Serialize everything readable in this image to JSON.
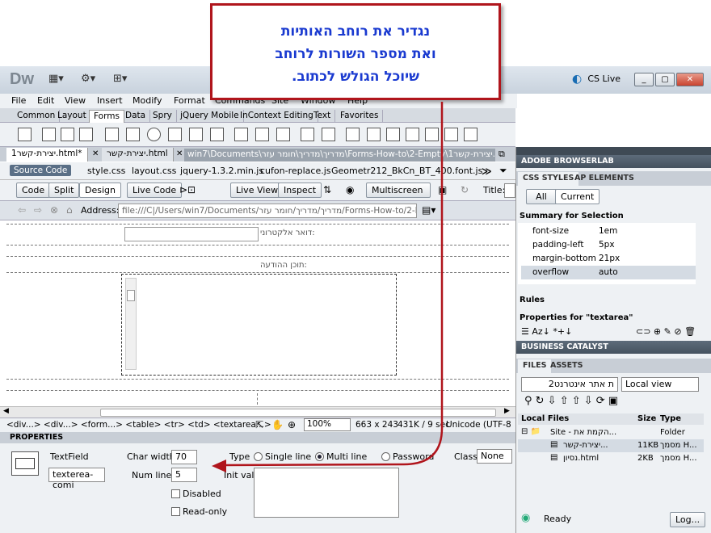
{
  "app": {
    "logo": "Dw",
    "cs_live": "CS Live"
  },
  "window_buttons": [
    "_",
    "▢",
    "✕"
  ],
  "menu": [
    "File",
    "Edit",
    "View",
    "Insert",
    "Modify",
    "Format",
    "Commands",
    "Site",
    "Window",
    "Help"
  ],
  "insert_tabs": [
    "Common",
    "Layout",
    "Forms",
    "Data",
    "Spry",
    "jQuery Mobile",
    "InContext Editing",
    "Text",
    "Favorites"
  ],
  "doc_tabs": [
    "יצירת-קשר1.html*",
    "יצירת-קשר.html",
    "win7\\Documents\\מדריך\\מדריך\\חומר עזר\\Forms-How-to\\2-Empty\\יצירת-קשר1.html"
  ],
  "related": {
    "source": "Source Code",
    "files": [
      "style.css",
      "layout.css",
      "jquery-1.3.2.min.js",
      "cufon-replace.js",
      "Geometr212_BkCn_BT_400.font.js"
    ]
  },
  "docbar": {
    "code": "Code",
    "split": "Split",
    "design": "Design",
    "live_code": "Live Code",
    "live_view": "Live View",
    "inspect": "Inspect",
    "multiscreen": "Multiscreen",
    "title_label": "Title:"
  },
  "address": {
    "label": "Address:",
    "value": "file:///C|/Users/win7/Documents/מדריך/מדריך/חומר עזר/Forms-How-to/2-En"
  },
  "design": {
    "label_email": "דואר אלקטרוני:",
    "label_message": "תוכן ההודעה:"
  },
  "status": {
    "tags": "<div...> <div...> <form...> <table> <tr> <td> <textarea...>",
    "zoom": "100%",
    "size": "663 x 243",
    "weight": "431K / 9 sec",
    "encoding": "Unicode (UTF-8"
  },
  "properties": {
    "header": "PROPERTIES",
    "type_name": "TextField",
    "field_id": "texterea-comi",
    "char_width_label": "Char width",
    "char_width": "70",
    "num_lines_label": "Num lines",
    "num_lines": "5",
    "type_label": "Type",
    "single": "Single line",
    "multi": "Multi line",
    "password": "Password",
    "class_label": "Class",
    "class_value": "None",
    "init_label": "Init val",
    "disabled": "Disabled",
    "readonly": "Read-only"
  },
  "right": {
    "browserlab": "ADOBE BROWSERLAB",
    "css_tab": "CSS STYLES",
    "ap_tab": "AP ELEMENTS",
    "all": "All",
    "current": "Current",
    "summary": "Summary for Selection",
    "rules": [
      {
        "k": "font-size",
        "v": "1em"
      },
      {
        "k": "padding-left",
        "v": "5px"
      },
      {
        "k": "margin-bottom",
        "v": "21px"
      },
      {
        "k": "overflow",
        "v": "auto"
      }
    ],
    "rules_label": "Rules",
    "props_for": "Properties for \"textarea\"",
    "business": "BUSINESS CATALYST",
    "files_tab": "FILES",
    "assets_tab": "ASSETS",
    "site": "ת אתר אינטרנט2",
    "view": "Local view",
    "col_local": "Local Files",
    "col_size": "Size",
    "col_type": "Type",
    "files": [
      {
        "name": "Site - הקמת את...",
        "size": "",
        "type": "Folder"
      },
      {
        "name": "יצירת-קשר...",
        "size": "11KB",
        "type": "מסמך H..."
      },
      {
        "name": "נסיון.html",
        "size": "2KB",
        "type": "מסמך H..."
      }
    ],
    "ready": "Ready",
    "log": "Log..."
  },
  "callout": {
    "lines": [
      "נגדיר את רוחב האותיות",
      "ואת מספר השורות לרוחב",
      "שיוכל הגולש לכתוב."
    ]
  },
  "colors": {
    "callout_border": "#b0151c",
    "callout_text": "#1a3ad0",
    "arrow": "#b0151c"
  }
}
